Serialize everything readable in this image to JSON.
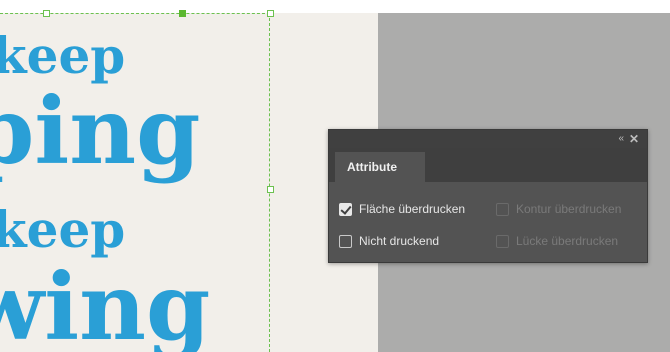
{
  "canvas": {
    "words": [
      "keep",
      "ping",
      "keep",
      "wing"
    ],
    "text_color": "#2a9fd6",
    "selection_color": "#6cc14f",
    "pasteboard_color": "#acacab"
  },
  "panel": {
    "collapse_icon": "«",
    "close_icon": "✕",
    "tab_label": "Attribute",
    "options": [
      {
        "label": "Fläche überdrucken",
        "checked": true,
        "enabled": true
      },
      {
        "label": "Kontur überdrucken",
        "checked": false,
        "enabled": false
      },
      {
        "label": "Nicht druckend",
        "checked": false,
        "enabled": true
      },
      {
        "label": "Lücke überdrucken",
        "checked": false,
        "enabled": false
      }
    ]
  }
}
